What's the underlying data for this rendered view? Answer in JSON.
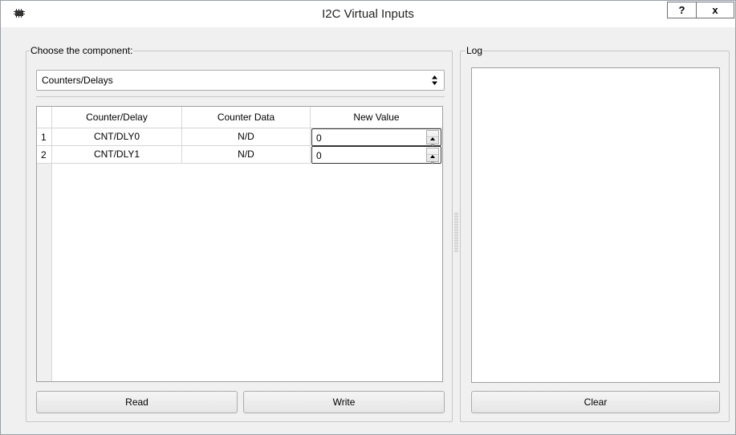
{
  "window": {
    "title": "I2C Virtual Inputs",
    "help_label": "?",
    "close_label": "x"
  },
  "component_group": {
    "legend": "Choose the component:",
    "combo_value": "Counters/Delays"
  },
  "table": {
    "headers": [
      "Counter/Delay",
      "Counter Data",
      "New Value"
    ],
    "rows": [
      {
        "num": "1",
        "name": "CNT/DLY0",
        "data": "N/D",
        "new_value": "0"
      },
      {
        "num": "2",
        "name": "CNT/DLY1",
        "data": "N/D",
        "new_value": "0"
      }
    ]
  },
  "buttons": {
    "read": "Read",
    "write": "Write",
    "clear": "Clear"
  },
  "log_group": {
    "legend": "Log"
  },
  "colors": {
    "window_bg": "#f0f0f0",
    "border": "#a0a0a0"
  }
}
